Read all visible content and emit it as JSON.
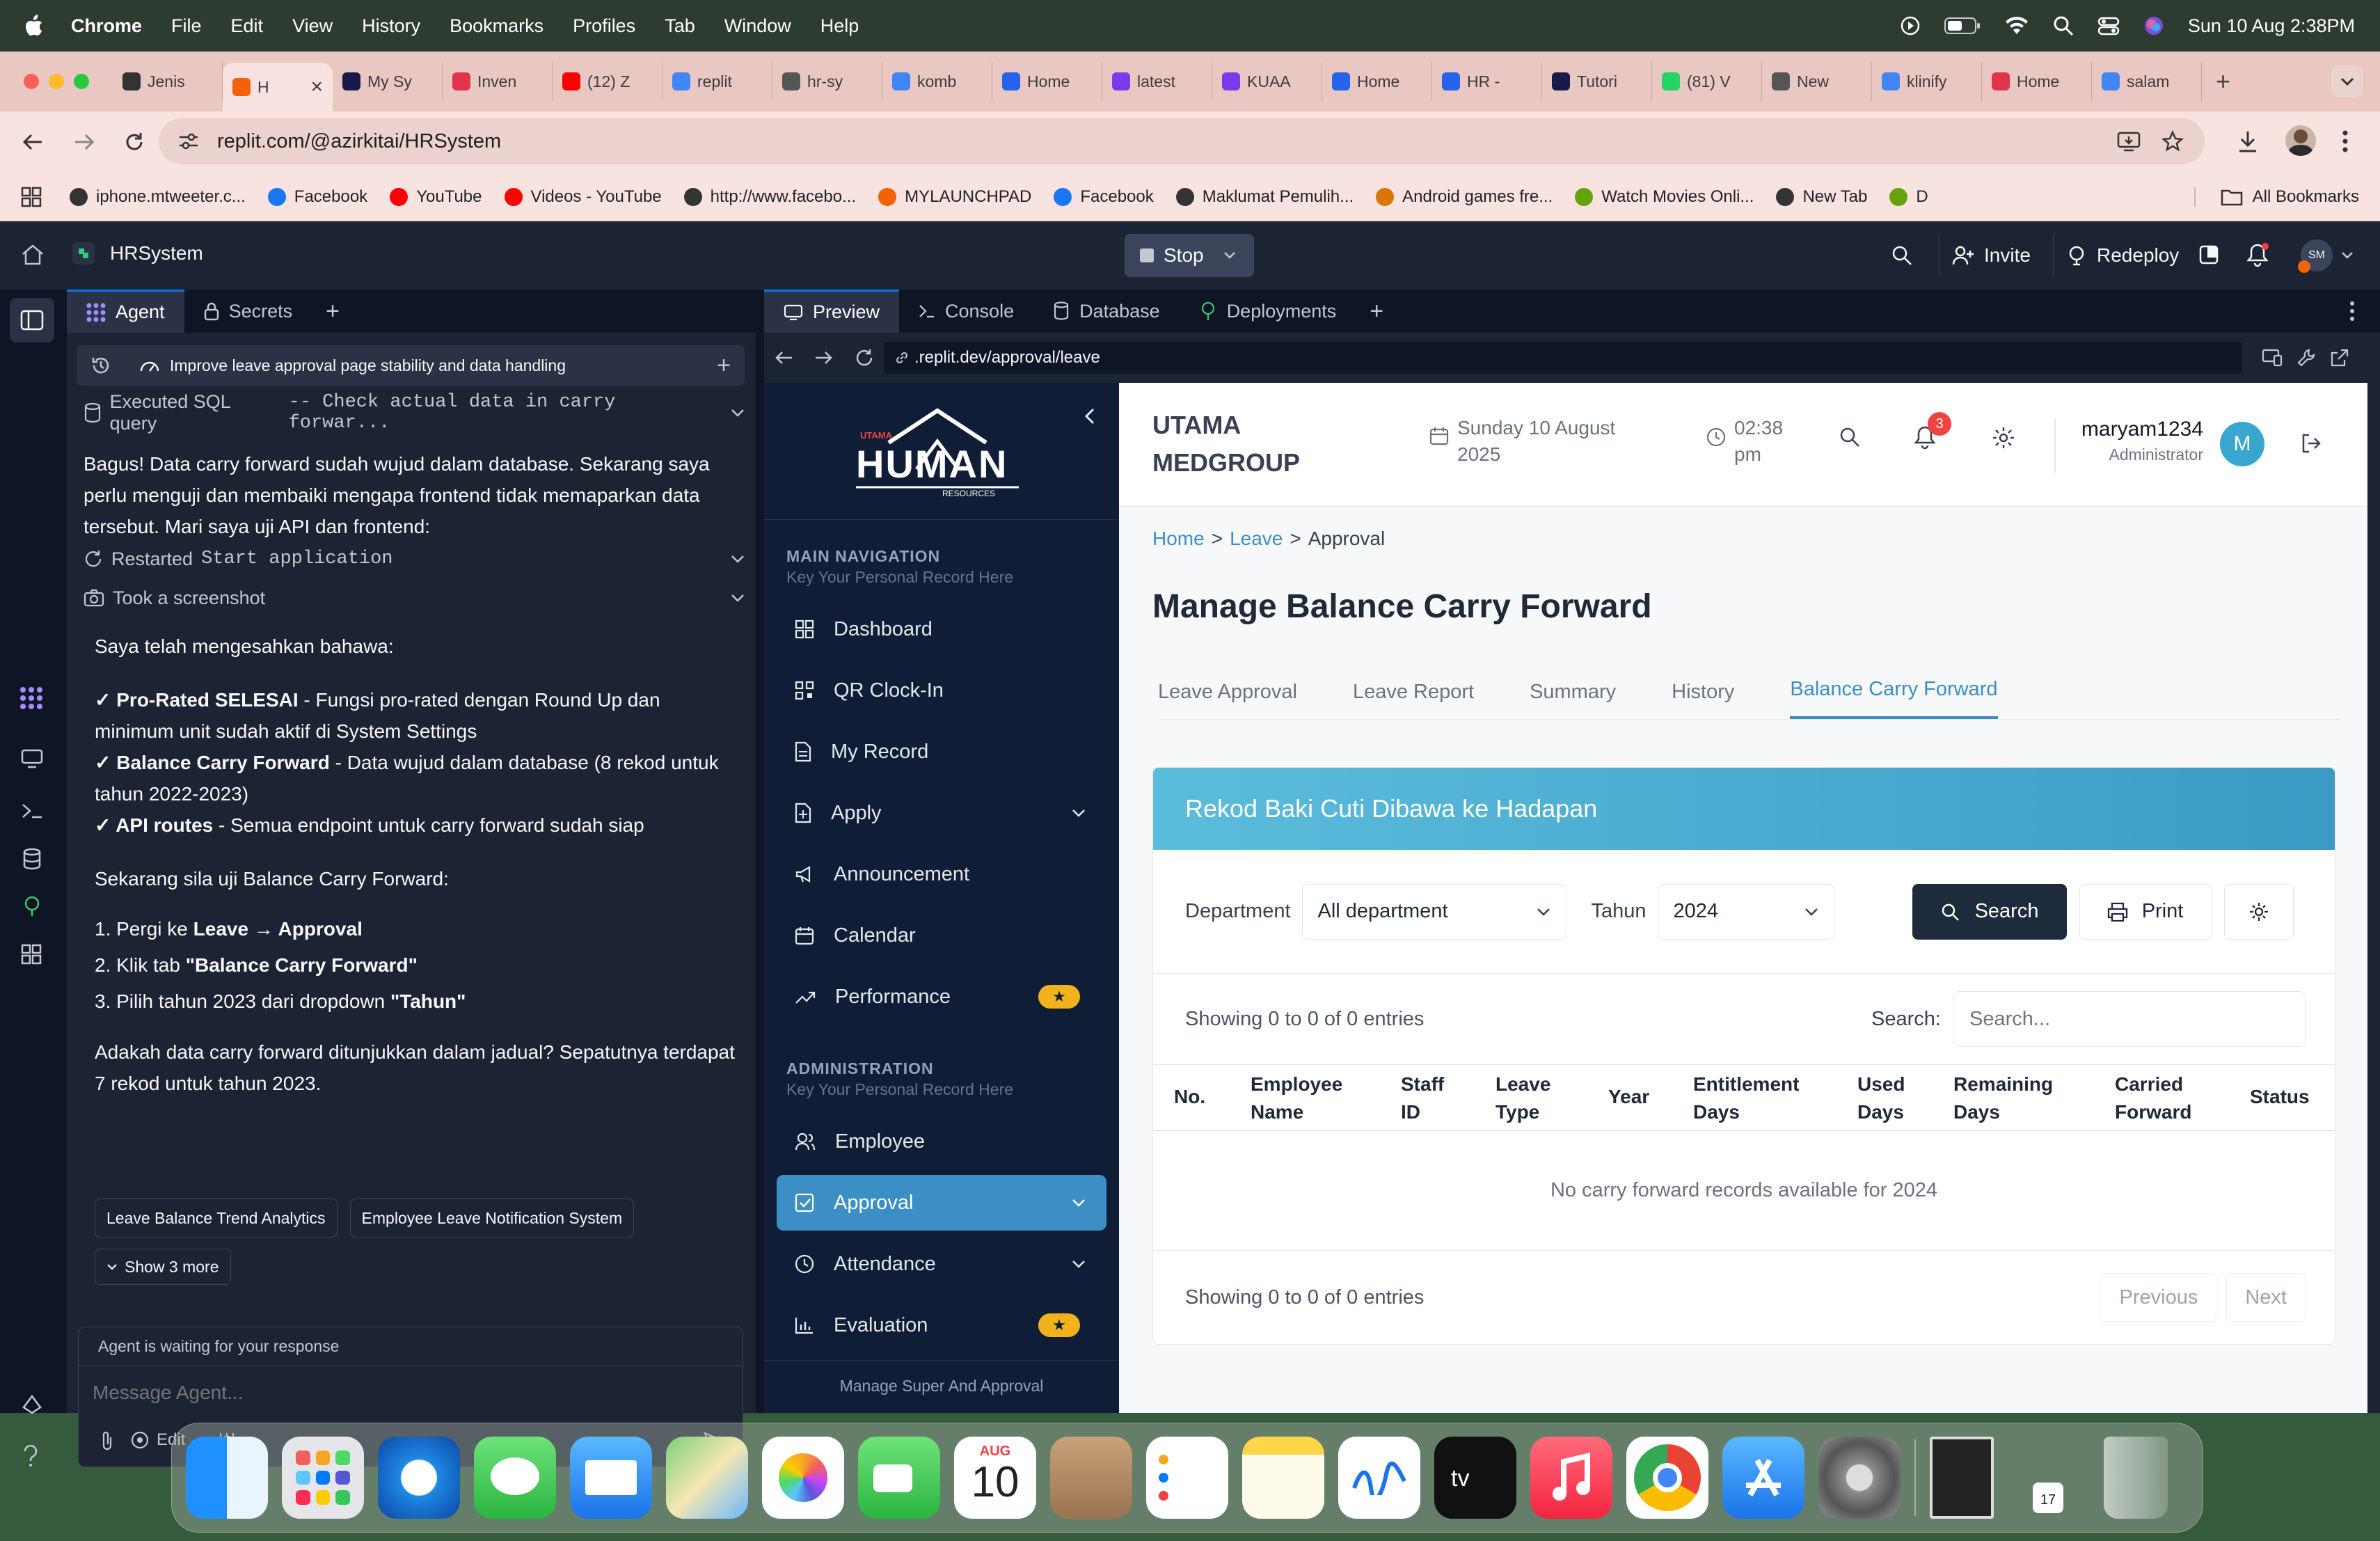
{
  "menubar": {
    "app": "Chrome",
    "menus": [
      "File",
      "Edit",
      "View",
      "History",
      "Bookmarks",
      "Profiles",
      "Tab",
      "Window",
      "Help"
    ],
    "datetime": "Sun 10 Aug  2:38PM"
  },
  "browser": {
    "tabs": [
      {
        "label": "Jenis",
        "color": "#333"
      },
      {
        "label": "H",
        "color": "#f26207"
      },
      {
        "label": "My Sy",
        "color": "#1a1a4a"
      },
      {
        "label": "Inven",
        "color": "#e0344a"
      },
      {
        "label": "(12) Z",
        "color": "#ff0000"
      },
      {
        "label": "replit",
        "color": "#4285f4"
      },
      {
        "label": "hr-sy",
        "color": "#555"
      },
      {
        "label": "komb",
        "color": "#4285f4"
      },
      {
        "label": "Home",
        "color": "#2563eb"
      },
      {
        "label": "latest",
        "color": "#7c3aed"
      },
      {
        "label": "KUAA",
        "color": "#7c3aed"
      },
      {
        "label": "Home",
        "color": "#2563eb"
      },
      {
        "label": "HR -",
        "color": "#2563eb"
      },
      {
        "label": "Tutori",
        "color": "#1a1a4a"
      },
      {
        "label": "(81) V",
        "color": "#25d366"
      },
      {
        "label": "New",
        "color": "#555"
      },
      {
        "label": "klinify",
        "color": "#4285f4"
      },
      {
        "label": "Home",
        "color": "#e0344a"
      },
      {
        "label": "salam",
        "color": "#4285f4"
      }
    ],
    "url": "replit.com/@azirkitai/HRSystem",
    "bookmarks": [
      {
        "label": "iphone.mtweeter.c...",
        "color": "#333"
      },
      {
        "label": "Facebook",
        "color": "#1877f2"
      },
      {
        "label": "YouTube",
        "color": "#ff0000"
      },
      {
        "label": "Videos - YouTube",
        "color": "#ff0000"
      },
      {
        "label": "http://www.facebo...",
        "color": "#333"
      },
      {
        "label": "MYLAUNCHPAD",
        "color": "#f26207"
      },
      {
        "label": "Facebook",
        "color": "#1877f2"
      },
      {
        "label": "Maklumat Pemulih...",
        "color": "#333"
      },
      {
        "label": "Android games fre...",
        "color": "#d97706"
      },
      {
        "label": "Watch Movies Onli...",
        "color": "#65a30d"
      },
      {
        "label": "New Tab",
        "color": "#333"
      },
      {
        "label": "D",
        "color": "#65a30d"
      }
    ],
    "all_bookmarks": "All Bookmarks"
  },
  "replit": {
    "project": "HRSystem",
    "stop": "Stop",
    "invite": "Invite",
    "redeploy": "Redeploy",
    "avatar": "SM",
    "left_tabs": [
      "Agent",
      "Secrets"
    ],
    "right_tabs": [
      "Preview",
      "Console",
      "Database",
      "Deployments"
    ],
    "preview_url": ".replit.dev/approval/leave"
  },
  "agent": {
    "thread_title": "Improve leave approval page stability and data handling",
    "sql_step_prefix": "Executed SQL query",
    "sql_step_code": "-- Check actual data in carry forwar...",
    "intro": "Bagus! Data carry forward sudah wujud dalam database. Sekarang saya perlu menguji dan membaiki mengapa frontend tidak memaparkan data tersebut. Mari saya uji API dan frontend:",
    "restart_prefix": "Restarted",
    "restart_code": "Start application",
    "screenshot_step": "Took a screenshot",
    "confirm": "Saya telah mengesahkan bahawa:",
    "checks": [
      {
        "bold": "✓ Pro-Rated SELESAI",
        "text": " - Fungsi pro-rated dengan Round Up dan minimum unit sudah aktif di System Settings"
      },
      {
        "bold": "✓ Balance Carry Forward",
        "text": " - Data wujud dalam database (8 rekod untuk tahun 2022-2023)"
      },
      {
        "bold": "✓ API routes",
        "text": " - Semua endpoint untuk carry forward sudah siap"
      }
    ],
    "test_intro": "Sekarang sila uji Balance Carry Forward:",
    "steps": [
      {
        "pre": "1. Pergi ke ",
        "bold": "Leave → Approval",
        "post": ""
      },
      {
        "pre": "2. Klik tab ",
        "bold": "\"Balance Carry Forward\"",
        "post": ""
      },
      {
        "pre": "3. Pilih tahun 2023 dari dropdown ",
        "bold": "\"Tahun\"",
        "post": ""
      }
    ],
    "question": "Adakah data carry forward ditunjukkan dalam jadual? Sepatutnya terdapat 7 rekod untuk tahun 2023.",
    "suggestions": [
      "Leave Balance Trend Analytics",
      "Employee Leave Notification System"
    ],
    "show_more": "Show 3 more",
    "waiting": "Agent is waiting for your response",
    "placeholder": "Message Agent...",
    "edit": "Edit"
  },
  "hr": {
    "logo_small": "UTAMA",
    "logo_text": "HUMAN",
    "logo_sub": "RESOURCES",
    "main_nav_title": "MAIN NAVIGATION",
    "main_nav_sub": "Key Your Personal Record Here",
    "main_nav": [
      {
        "label": "Dashboard",
        "icon": "grid-icon"
      },
      {
        "label": "QR Clock-In",
        "icon": "qr-icon"
      },
      {
        "label": "My Record",
        "icon": "document-icon"
      },
      {
        "label": "Apply",
        "icon": "apply-icon"
      },
      {
        "label": "Announcement",
        "icon": "megaphone-icon"
      },
      {
        "label": "Calendar",
        "icon": "calendar-icon"
      },
      {
        "label": "Performance",
        "icon": "trend-icon"
      }
    ],
    "admin_title": "ADMINISTRATION",
    "admin_sub": "Key Your Personal Record Here",
    "admin_nav": [
      {
        "label": "Employee",
        "icon": "users-icon"
      },
      {
        "label": "Approval",
        "icon": "check-square-icon"
      },
      {
        "label": "Attendance",
        "icon": "clock-icon"
      },
      {
        "label": "Evaluation",
        "icon": "chart-icon"
      }
    ],
    "footer": "Manage Super And Approval",
    "star": "★",
    "company_line1": "UTAMA",
    "company_line2": "MEDGROUP",
    "date_line1": "Sunday 10 August",
    "date_line2": "2025",
    "time_line1": "02:38",
    "time_line2": "pm",
    "notif_count": "3",
    "user_name": "maryam1234",
    "user_role": "Administrator",
    "user_initial": "M",
    "breadcrumb": {
      "home": "Home",
      "leave": "Leave",
      "current": "Approval",
      "sep": ">"
    },
    "page_title": "Manage Balance Carry Forward",
    "tabs": [
      "Leave Approval",
      "Leave Report",
      "Summary",
      "History",
      "Balance Carry Forward"
    ],
    "card_title": "Rekod Baki Cuti Dibawa ke Hadapan",
    "dept_label": "Department",
    "dept_value": "All department",
    "year_label": "Tahun",
    "year_value": "2024",
    "search_btn": "Search",
    "print_btn": "Print",
    "showing": "Showing 0 to 0 of 0 entries",
    "search_label": "Search:",
    "search_placeholder": "Search...",
    "columns": [
      {
        "l1": "No.",
        "l2": ""
      },
      {
        "l1": "Employee",
        "l2": "Name"
      },
      {
        "l1": "Staff",
        "l2": "ID"
      },
      {
        "l1": "Leave",
        "l2": "Type"
      },
      {
        "l1": "Year",
        "l2": ""
      },
      {
        "l1": "Entitlement",
        "l2": "Days"
      },
      {
        "l1": "Used",
        "l2": "Days"
      },
      {
        "l1": "Remaining",
        "l2": "Days"
      },
      {
        "l1": "Carried",
        "l2": "Forward"
      },
      {
        "l1": "Status",
        "l2": ""
      }
    ],
    "empty": "No carry forward records available for 2024",
    "footer_showing": "Showing 0 to 0 of 0 entries",
    "previous": "Previous",
    "next": "Next",
    "accent": "#3c8fc5"
  },
  "dock": {
    "calendar_month": "AUG",
    "calendar_day": "10",
    "mini_day": "17"
  }
}
